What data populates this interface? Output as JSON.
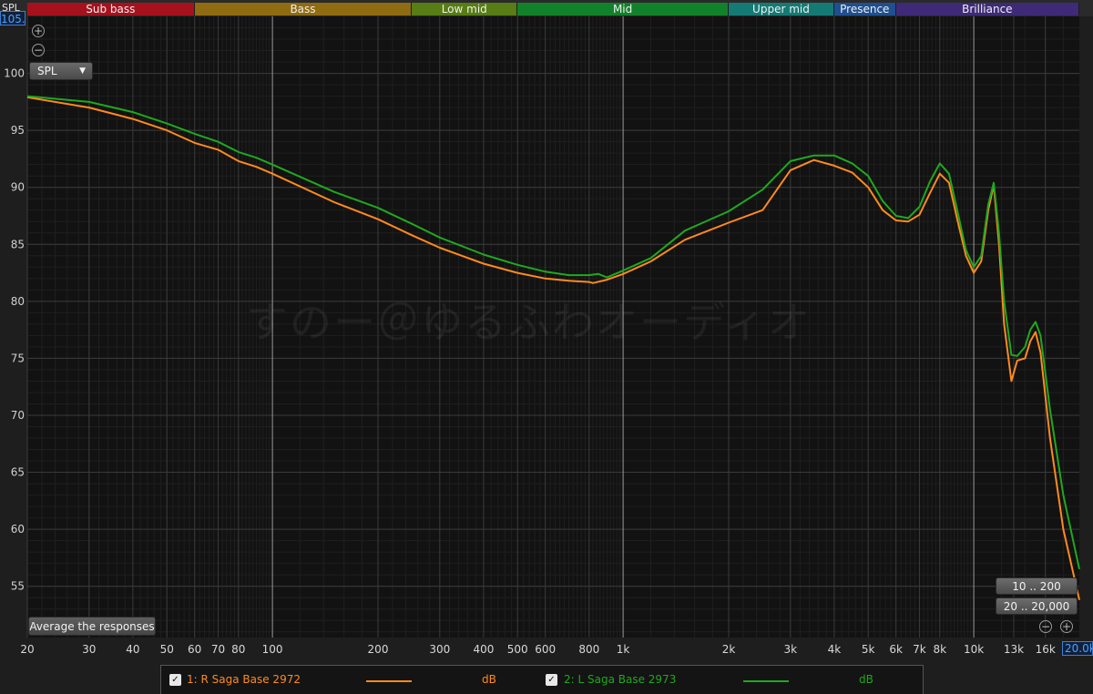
{
  "header": {
    "ylim_label": "SPL",
    "ylim_max_text": "105.00"
  },
  "bands": [
    {
      "label": "Sub bass",
      "from": 20,
      "to": 60,
      "color": "#a5121e"
    },
    {
      "label": "Bass",
      "from": 60,
      "to": 250,
      "color": "#8f6b12"
    },
    {
      "label": "Low mid",
      "from": 250,
      "to": 500,
      "color": "#577d14"
    },
    {
      "label": "Mid",
      "from": 500,
      "to": 2000,
      "color": "#12822a"
    },
    {
      "label": "Upper mid",
      "from": 2000,
      "to": 4000,
      "color": "#157a74"
    },
    {
      "label": "Presence",
      "from": 4000,
      "to": 6000,
      "color": "#1f4f8f"
    },
    {
      "label": "Brilliance",
      "from": 6000,
      "to": 20000,
      "color": "#3f2a78"
    }
  ],
  "toolbar": {
    "spl_select": "SPL",
    "average_button": "Average the responses",
    "range_low": "10 .. 200",
    "range_high": "20 .. 20,000",
    "xmax_text": "20.0k"
  },
  "watermark": "すのー＠ゆるふわオーディオ",
  "legend": {
    "items": [
      {
        "check": "✓",
        "name": "1: R Saga Base 2972",
        "unit": "dB",
        "color": "#ff8a1e"
      },
      {
        "check": "✓",
        "name": "2: L Saga Base 2973",
        "unit": "dB",
        "color": "#1fa81f"
      }
    ]
  },
  "chart_data": {
    "type": "line",
    "x_scale": "log",
    "xlim": [
      20,
      20000
    ],
    "ylim": [
      50.5,
      105
    ],
    "grid": true,
    "legend_position": "bottom",
    "x_ticks": [
      {
        "value": 20,
        "label": "20"
      },
      {
        "value": 30,
        "label": "30"
      },
      {
        "value": 40,
        "label": "40"
      },
      {
        "value": 50,
        "label": "50"
      },
      {
        "value": 60,
        "label": "60"
      },
      {
        "value": 70,
        "label": "70"
      },
      {
        "value": 80,
        "label": "80"
      },
      {
        "value": 100,
        "label": "100"
      },
      {
        "value": 200,
        "label": "200"
      },
      {
        "value": 300,
        "label": "300"
      },
      {
        "value": 400,
        "label": "400"
      },
      {
        "value": 500,
        "label": "500"
      },
      {
        "value": 600,
        "label": "600"
      },
      {
        "value": 800,
        "label": "800"
      },
      {
        "value": 1000,
        "label": "1k"
      },
      {
        "value": 2000,
        "label": "2k"
      },
      {
        "value": 3000,
        "label": "3k"
      },
      {
        "value": 4000,
        "label": "4k"
      },
      {
        "value": 5000,
        "label": "5k"
      },
      {
        "value": 6000,
        "label": "6k"
      },
      {
        "value": 7000,
        "label": "7k"
      },
      {
        "value": 8000,
        "label": "8k"
      },
      {
        "value": 10000,
        "label": "10k"
      },
      {
        "value": 13000,
        "label": "13k"
      },
      {
        "value": 16000,
        "label": "16k"
      }
    ],
    "y_ticks": [
      {
        "value": 55,
        "label": "55"
      },
      {
        "value": 60,
        "label": "60"
      },
      {
        "value": 65,
        "label": "65"
      },
      {
        "value": 70,
        "label": "70"
      },
      {
        "value": 75,
        "label": "75"
      },
      {
        "value": 80,
        "label": "80"
      },
      {
        "value": 85,
        "label": "85"
      },
      {
        "value": 90,
        "label": "90"
      },
      {
        "value": 95,
        "label": "95"
      },
      {
        "value": 100,
        "label": "100"
      }
    ],
    "series": [
      {
        "name": "1: R Saga Base 2972",
        "color": "#ff8a1e",
        "points": [
          [
            20,
            97.9
          ],
          [
            30,
            97.0
          ],
          [
            40,
            96.0
          ],
          [
            50,
            95.0
          ],
          [
            60,
            93.9
          ],
          [
            70,
            93.3
          ],
          [
            80,
            92.3
          ],
          [
            90,
            91.8
          ],
          [
            100,
            91.2
          ],
          [
            150,
            88.7
          ],
          [
            200,
            87.2
          ],
          [
            250,
            85.8
          ],
          [
            300,
            84.7
          ],
          [
            400,
            83.3
          ],
          [
            500,
            82.5
          ],
          [
            600,
            82.0
          ],
          [
            700,
            81.8
          ],
          [
            800,
            81.7
          ],
          [
            820,
            81.6
          ],
          [
            900,
            81.9
          ],
          [
            1000,
            82.4
          ],
          [
            1200,
            83.5
          ],
          [
            1500,
            85.4
          ],
          [
            2000,
            86.9
          ],
          [
            2500,
            88.0
          ],
          [
            3000,
            91.5
          ],
          [
            3500,
            92.4
          ],
          [
            4000,
            91.9
          ],
          [
            4500,
            91.3
          ],
          [
            5000,
            90.0
          ],
          [
            5500,
            88.0
          ],
          [
            6000,
            87.1
          ],
          [
            6500,
            87.0
          ],
          [
            7000,
            87.6
          ],
          [
            7500,
            89.5
          ],
          [
            8000,
            91.2
          ],
          [
            8500,
            90.4
          ],
          [
            9000,
            87.0
          ],
          [
            9500,
            84.0
          ],
          [
            10000,
            82.5
          ],
          [
            10500,
            83.5
          ],
          [
            11000,
            88.0
          ],
          [
            11400,
            90.2
          ],
          [
            11800,
            85.0
          ],
          [
            12200,
            78.0
          ],
          [
            12800,
            73.0
          ],
          [
            13300,
            74.8
          ],
          [
            14000,
            75.0
          ],
          [
            14500,
            76.5
          ],
          [
            15000,
            77.3
          ],
          [
            15500,
            75.5
          ],
          [
            16500,
            68.0
          ],
          [
            18000,
            60.0
          ],
          [
            20000,
            53.8
          ]
        ]
      },
      {
        "name": "2: L Saga Base 2973",
        "color": "#1fa81f",
        "points": [
          [
            20,
            98.0
          ],
          [
            30,
            97.5
          ],
          [
            40,
            96.6
          ],
          [
            50,
            95.6
          ],
          [
            60,
            94.7
          ],
          [
            70,
            94.0
          ],
          [
            80,
            93.1
          ],
          [
            90,
            92.6
          ],
          [
            100,
            92.0
          ],
          [
            150,
            89.6
          ],
          [
            200,
            88.2
          ],
          [
            250,
            86.8
          ],
          [
            300,
            85.6
          ],
          [
            400,
            84.1
          ],
          [
            500,
            83.2
          ],
          [
            600,
            82.6
          ],
          [
            700,
            82.3
          ],
          [
            800,
            82.3
          ],
          [
            850,
            82.4
          ],
          [
            900,
            82.1
          ],
          [
            1000,
            82.7
          ],
          [
            1200,
            83.8
          ],
          [
            1500,
            86.2
          ],
          [
            2000,
            87.9
          ],
          [
            2500,
            89.8
          ],
          [
            3000,
            92.3
          ],
          [
            3500,
            92.8
          ],
          [
            4000,
            92.8
          ],
          [
            4500,
            92.1
          ],
          [
            5000,
            91.0
          ],
          [
            5500,
            88.8
          ],
          [
            6000,
            87.5
          ],
          [
            6500,
            87.3
          ],
          [
            7000,
            88.3
          ],
          [
            7500,
            90.5
          ],
          [
            8000,
            92.1
          ],
          [
            8500,
            91.2
          ],
          [
            9000,
            87.8
          ],
          [
            9500,
            84.5
          ],
          [
            10000,
            83.0
          ],
          [
            10500,
            84.0
          ],
          [
            11000,
            88.5
          ],
          [
            11400,
            90.4
          ],
          [
            11800,
            86.0
          ],
          [
            12200,
            80.0
          ],
          [
            12800,
            75.3
          ],
          [
            13300,
            75.2
          ],
          [
            14000,
            76.0
          ],
          [
            14500,
            77.5
          ],
          [
            15000,
            78.2
          ],
          [
            15500,
            77.0
          ],
          [
            16500,
            70.5
          ],
          [
            18000,
            63.0
          ],
          [
            20000,
            56.5
          ]
        ]
      }
    ]
  }
}
